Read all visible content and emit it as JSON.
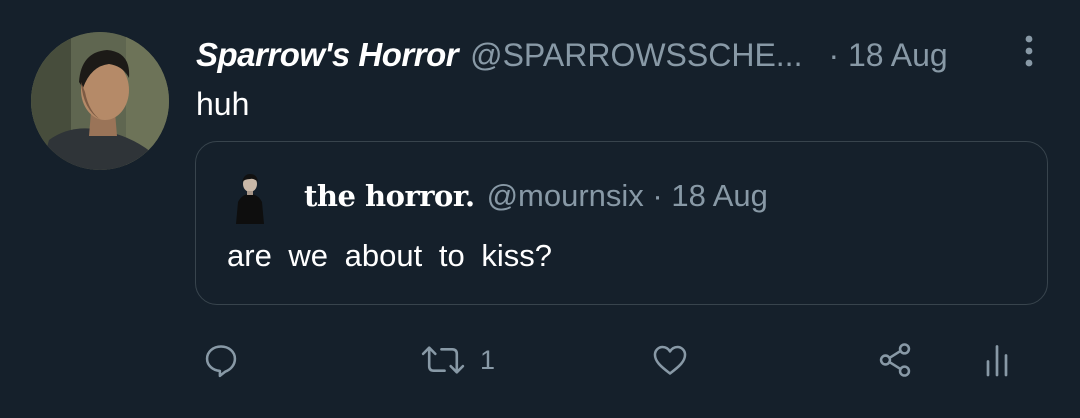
{
  "tweet": {
    "display_name": "Sparrow's Horror",
    "handle": "@SPARROWSSCHE...",
    "date": "· 18 Aug",
    "text": "huh"
  },
  "quoted_tweet": {
    "display_name": "the horror.",
    "handle": "@mournsix · 18 Aug",
    "text": "are we about to kiss?"
  },
  "actions": {
    "reply_icon": "reply-icon",
    "retweet_icon": "retweet-icon",
    "retweet_count": "1",
    "like_icon": "heart-icon",
    "share_icon": "share-icon",
    "analytics_icon": "analytics-icon"
  },
  "colors": {
    "background": "#15202b",
    "secondary_text": "#8899a6",
    "border": "#38444d",
    "primary_text": "#ffffff"
  }
}
